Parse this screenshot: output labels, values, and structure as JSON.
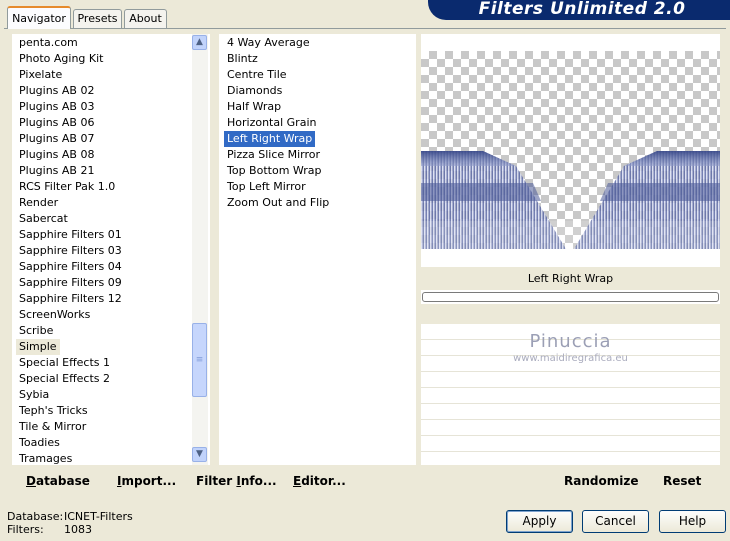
{
  "tabs": [
    {
      "label": "Navigator",
      "active": true
    },
    {
      "label": "Presets",
      "active": false
    },
    {
      "label": "About",
      "active": false
    }
  ],
  "brand": "Filters Unlimited 2.0",
  "categories": {
    "items": [
      "penta.com",
      "Photo Aging Kit",
      "Pixelate",
      "Plugins AB 02",
      "Plugins AB 03",
      "Plugins AB 06",
      "Plugins AB 07",
      "Plugins AB 08",
      "Plugins AB 21",
      "RCS Filter Pak 1.0",
      "Render",
      "Sabercat",
      "Sapphire Filters 01",
      "Sapphire Filters 03",
      "Sapphire Filters 04",
      "Sapphire Filters 09",
      "Sapphire Filters 12",
      "ScreenWorks",
      "Scribe",
      "Simple",
      "Special Effects 1",
      "Special Effects 2",
      "Sybia",
      "Teph's Tricks",
      "Tile & Mirror",
      "Toadies",
      "Tramages"
    ],
    "selected": "Simple"
  },
  "filters": {
    "items": [
      "4 Way Average",
      "Blintz",
      "Centre Tile",
      "Diamonds",
      "Half Wrap",
      "Horizontal Grain",
      "Left Right Wrap",
      "Pizza Slice Mirror",
      "Top Bottom Wrap",
      "Top Left Mirror",
      "Zoom Out and Flip"
    ],
    "selected": "Left Right Wrap"
  },
  "toolbar": {
    "database": {
      "pre": "",
      "u": "D",
      "post": "atabase"
    },
    "import": {
      "pre": "",
      "u": "I",
      "post": "mport..."
    },
    "filter_info": {
      "pre": "Filter ",
      "u": "I",
      "post": "nfo..."
    },
    "editor": {
      "pre": "",
      "u": "E",
      "post": "ditor..."
    },
    "randomize": "Randomize",
    "reset": "Reset"
  },
  "preview": {
    "filter_name": "Left Right Wrap",
    "progress": 0,
    "watermark_name": "Pinuccia",
    "watermark_url": "www.maidiregrafica.eu"
  },
  "status": {
    "database_label": "Database:",
    "database_value": "ICNET-Filters",
    "filters_label": "Filters:",
    "filters_value": "1083"
  },
  "buttons": {
    "apply": "Apply",
    "cancel": "Cancel",
    "help": "Help"
  },
  "colors": {
    "accent": "#316ac5",
    "banner": "#0a2a6e",
    "tab_highlight": "#e68b2c"
  }
}
